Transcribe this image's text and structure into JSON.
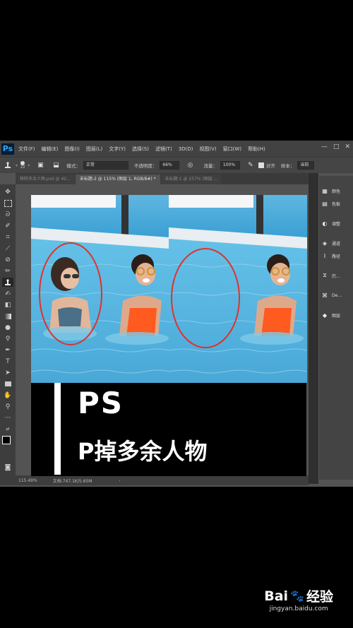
{
  "app": {
    "logo": "Ps",
    "menu": [
      "文件(F)",
      "编辑(E)",
      "图像(I)",
      "图层(L)",
      "文字(Y)",
      "选择(S)",
      "滤镜(T)",
      "3D(D)",
      "视图(V)",
      "窗口(W)",
      "帮助(H)"
    ],
    "window_controls": [
      "—",
      "□",
      "✕"
    ]
  },
  "options": {
    "brush_size": "22",
    "mode_label": "模式：",
    "mode_value": "正常",
    "opacity_label": "不透明度：",
    "opacity_value": "66%",
    "flow_label": "流量：",
    "flow_value": "100%",
    "align_label": "对齐",
    "sample_label": "样本：",
    "sample_value": "当前"
  },
  "tabs": [
    {
      "label": "移除多余人物.psd @ 42...",
      "active": false
    },
    {
      "label": "未标题-2 @ 115% (图层 1, RGB/8#) *",
      "active": true
    },
    {
      "label": "未标题-1 @ 257% (图层 ...",
      "active": false
    }
  ],
  "panels": [
    {
      "icon": "palette-icon",
      "glyph": "▦",
      "label": "颜色"
    },
    {
      "icon": "swatches-icon",
      "glyph": "▤",
      "label": "色板"
    },
    {
      "icon": "adjustments-icon",
      "glyph": "◐",
      "label": "调整"
    },
    {
      "icon": "channels-icon",
      "glyph": "◈",
      "label": "通道"
    },
    {
      "icon": "paths-icon",
      "glyph": "⌇",
      "label": "路径"
    },
    {
      "icon": "history-icon",
      "glyph": "⧖",
      "label": "历..."
    },
    {
      "icon": "details-icon",
      "glyph": "⌘",
      "label": "De..."
    },
    {
      "icon": "layers-icon",
      "glyph": "◆",
      "label": "图层"
    }
  ],
  "status": {
    "zoom": "115.49%",
    "doc": "文档:747.1K/5.65M"
  },
  "banner": {
    "title": "PS",
    "subtitle": "P掉多余人物"
  },
  "watermark": {
    "brand": "Bai",
    "brand_suffix": "经验",
    "url": "jingyan.baidu.com"
  }
}
